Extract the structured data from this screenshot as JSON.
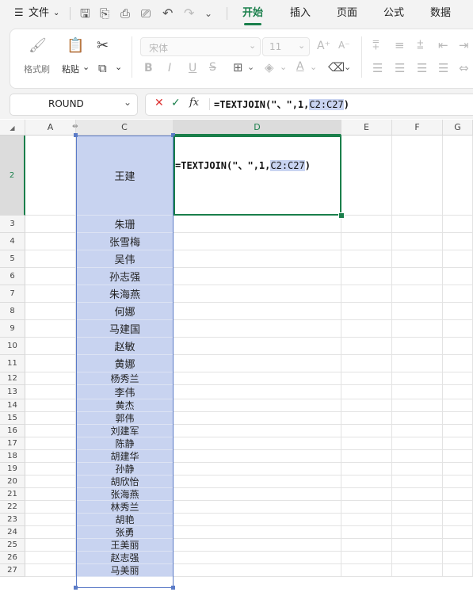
{
  "menubar": {
    "menu_icon": "☰",
    "file_label": "文件",
    "tabs": [
      {
        "label": "开始",
        "active": true
      },
      {
        "label": "插入",
        "active": false
      },
      {
        "label": "页面",
        "active": false
      },
      {
        "label": "公式",
        "active": false
      },
      {
        "label": "数据",
        "active": false
      }
    ]
  },
  "ribbon": {
    "format_painter_label": "格式刷",
    "paste_label": "粘贴",
    "font_name": "宋体",
    "font_size": "11",
    "bold": "B",
    "italic": "I",
    "underline": "U",
    "font_grow": "A⁺",
    "font_shrink": "A⁻"
  },
  "formula_bar": {
    "name_box": "ROUND",
    "fx_label": "fx",
    "formula_prefix": "=TEXTJOIN(\"、\",1,",
    "formula_ref": "C2:C27",
    "formula_suffix": ")"
  },
  "columns": [
    "A",
    "C",
    "D",
    "E",
    "F",
    "G"
  ],
  "active_cell": {
    "column": "D",
    "row": "2",
    "edit_prefix": "=TEXTJOIN(\"、\",1,",
    "edit_ref": "C2:C27",
    "edit_suffix": ")"
  },
  "rows": [
    {
      "num": "2",
      "name": "王建"
    },
    {
      "num": "3",
      "name": "朱珊"
    },
    {
      "num": "4",
      "name": "张雪梅"
    },
    {
      "num": "5",
      "name": "吴伟"
    },
    {
      "num": "6",
      "name": "孙志强"
    },
    {
      "num": "7",
      "name": "朱海燕"
    },
    {
      "num": "8",
      "name": "何娜"
    },
    {
      "num": "9",
      "name": "马建国"
    },
    {
      "num": "10",
      "name": "赵敏"
    },
    {
      "num": "11",
      "name": "黄娜"
    },
    {
      "num": "12",
      "name": "杨秀兰"
    },
    {
      "num": "13",
      "name": "李伟"
    },
    {
      "num": "14",
      "name": "黄杰"
    },
    {
      "num": "15",
      "name": "郭伟"
    },
    {
      "num": "16",
      "name": "刘建军"
    },
    {
      "num": "17",
      "name": "陈静"
    },
    {
      "num": "18",
      "name": "胡建华"
    },
    {
      "num": "19",
      "name": "孙静"
    },
    {
      "num": "20",
      "name": "胡欣怡"
    },
    {
      "num": "21",
      "name": "张海燕"
    },
    {
      "num": "22",
      "name": "林秀兰"
    },
    {
      "num": "23",
      "name": "胡艳"
    },
    {
      "num": "24",
      "name": "张勇"
    },
    {
      "num": "25",
      "name": "王美丽"
    },
    {
      "num": "26",
      "name": "赵志强"
    },
    {
      "num": "27",
      "name": "马美丽"
    }
  ],
  "colors": {
    "accent": "#1a7f4b",
    "selection": "#c8d3f0",
    "selection_border": "#5b7bc7"
  }
}
